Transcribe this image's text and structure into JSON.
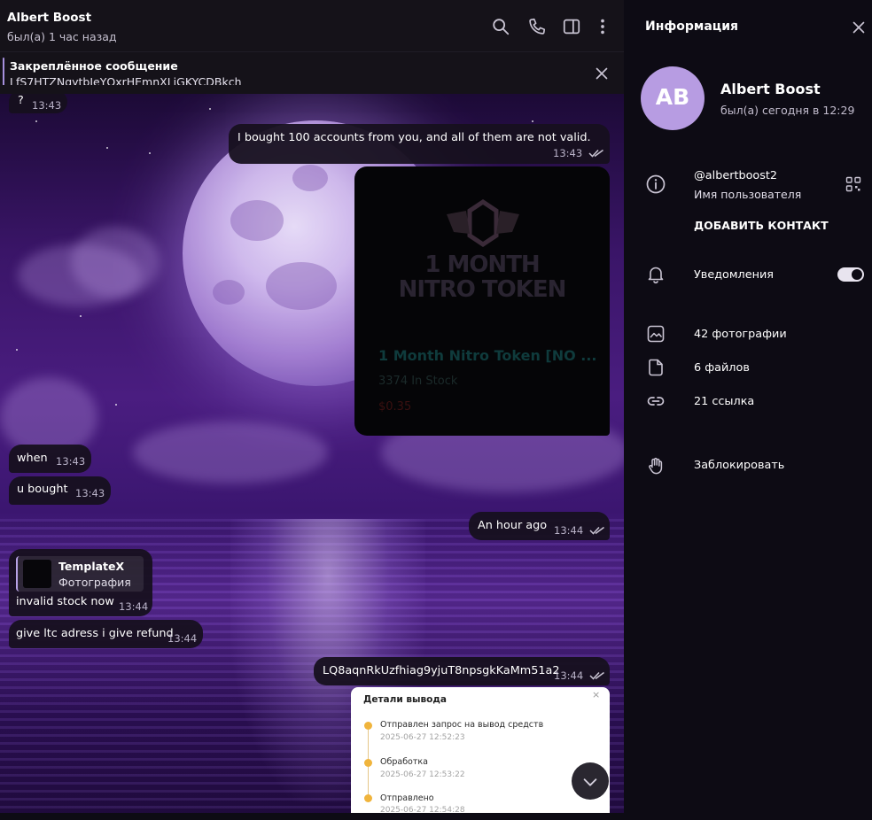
{
  "header": {
    "title": "Albert Boost",
    "status": "был(а) 1 час назад",
    "icons": [
      "search-icon",
      "phone-icon",
      "sidebar-toggle-icon",
      "more-vertical-icon"
    ]
  },
  "pinned": {
    "title": "Закреплённое сообщение",
    "text": "LfS7HTZNqytbJeYQxrHEmnXLjGKYCDBkch"
  },
  "messages": {
    "m0": {
      "text": "?",
      "time": "13:43"
    },
    "m1": {
      "text": "I bought 100 accounts from you, and all of them are not valid.",
      "time": "13:43"
    },
    "card": {
      "logo_line1": "1 MONTH",
      "logo_line2": "NITRO TOKEN",
      "title": "1 Month Nitro Token [NO ...",
      "stock": "3374 In Stock",
      "price": "$0.35"
    },
    "m2": {
      "text": "when",
      "time": "13:43"
    },
    "m3": {
      "text": "u bought",
      "time": "13:43"
    },
    "m4": {
      "text": "An hour ago",
      "time": "13:44"
    },
    "m5": {
      "reply_name": "TemplateX",
      "reply_type": "Фотография",
      "text": "invalid stock now",
      "time": "13:44"
    },
    "m6": {
      "text": "give ltc adress i give refund",
      "time": "13:44"
    },
    "m7": {
      "text": "LQ8aqnRkUzfhiag9yjuT8npsgkKaMm51a2",
      "time": "13:44"
    },
    "withdrawal": {
      "title": "Детали вывода",
      "close": "×",
      "steps": [
        {
          "title": "Отправлен запрос на вывод средств",
          "date": "2025-06-27 12:52:23"
        },
        {
          "title": "Обработка",
          "date": "2025-06-27 12:53:22"
        },
        {
          "title": "Отправлено",
          "date": "2025-06-27 12:54:28"
        }
      ]
    }
  },
  "info": {
    "title": "Информация",
    "avatar_initials": "AB",
    "name": "Albert Boost",
    "status": "был(а) сегодня в 12:29",
    "username": "@albertboost2",
    "username_label": "Имя пользователя",
    "add_contact": "ДОБАВИТЬ КОНТАКТ",
    "notifications": "Уведомления",
    "notifications_on": true,
    "photos": "42 фотографии",
    "files": "6 файлов",
    "links": "21 ссылка",
    "block": "Заблокировать"
  },
  "colors": {
    "accent": "#b79ce2",
    "header_bg": "#151219",
    "panel_bg": "#0d0b14",
    "bubble_bg": "#16101e",
    "timeline_dot": "#f0b43c"
  }
}
